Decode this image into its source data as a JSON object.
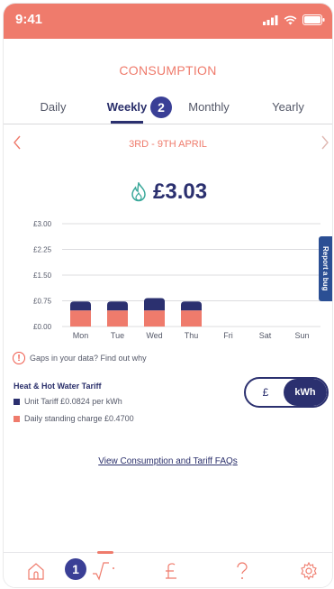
{
  "status_bar": {
    "time": "9:41"
  },
  "page_title": "CONSUMPTION",
  "tabs": [
    {
      "label": "Daily"
    },
    {
      "label": "Weekly"
    },
    {
      "label": "Monthly"
    },
    {
      "label": "Yearly"
    }
  ],
  "tabs_badge": "2",
  "period": {
    "label": "3RD - 9TH APRIL",
    "prev_icon": "chevron-left-icon",
    "next_icon": "chevron-right-icon"
  },
  "total": {
    "value": "£3.03",
    "icon": "flame-icon"
  },
  "chart_data": {
    "type": "bar",
    "categories": [
      "Mon",
      "Tue",
      "Wed",
      "Thu",
      "Fri",
      "Sat",
      "Sun"
    ],
    "y_ticks": [
      "£3.00",
      "£2.25",
      "£1.50",
      "£0.75",
      "£0.00"
    ],
    "ylim": [
      0,
      3.0
    ],
    "stacked": true,
    "series": [
      {
        "values": [
          0.47,
          0.47,
          0.47,
          0.47,
          0,
          0,
          0
        ],
        "color": "#ef7b6c"
      },
      {
        "values": [
          0.26,
          0.26,
          0.36,
          0.26,
          0,
          0,
          0
        ],
        "color": "#2b306f"
      }
    ]
  },
  "report_bug": "Report a bug",
  "gaps": {
    "text": "Gaps in your data? Find out why",
    "icon": "alert-icon"
  },
  "tariff": {
    "title": "Heat & Hot Water Tariff",
    "unit": "Unit Tariff £0.0824 per kWh",
    "standing": "Daily standing charge £0.4700",
    "unit_color": "#2b306f",
    "standing_color": "#ef7b6c"
  },
  "toggle": {
    "left": "£",
    "right": "kWh",
    "selected": "kWh"
  },
  "faq_link": "View Consumption and Tariff FAQs",
  "bottom_nav": [
    {
      "icon": "home-icon"
    },
    {
      "icon": "consumption-icon",
      "active": true
    },
    {
      "icon": "pound-icon"
    },
    {
      "icon": "help-icon"
    },
    {
      "icon": "settings-icon"
    }
  ],
  "nav_badge": "1",
  "colors": {
    "accent": "#ef7b6c",
    "navy": "#2b306f",
    "badge": "#3a3f96"
  }
}
